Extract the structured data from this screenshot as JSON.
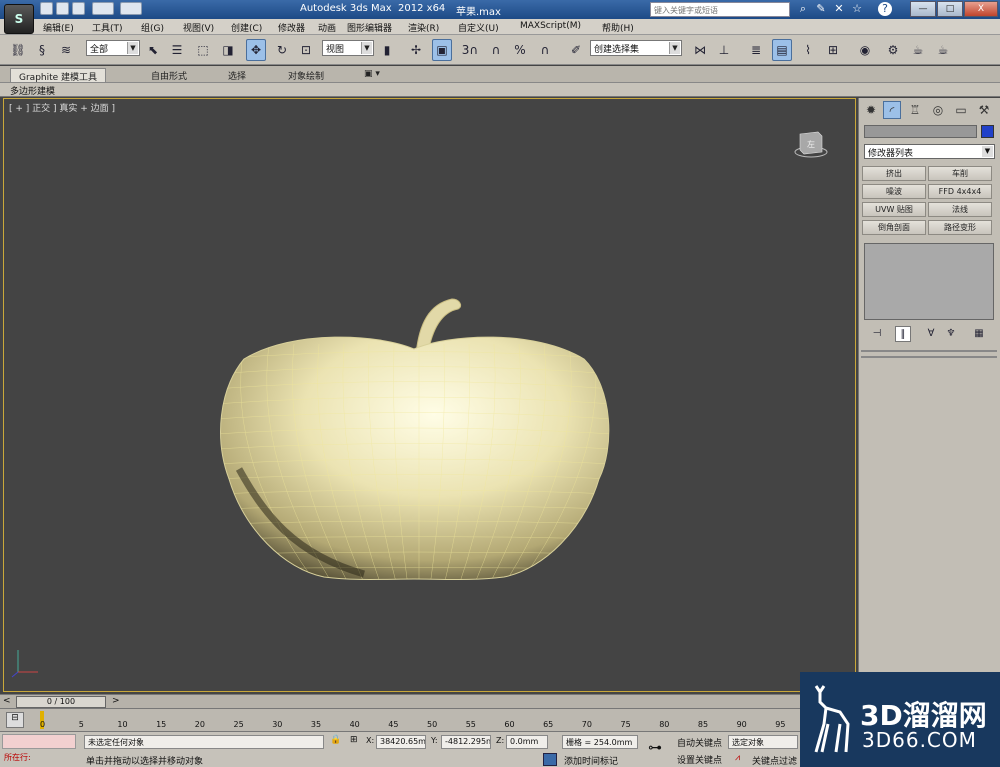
{
  "titlebar": {
    "app_title": "Autodesk 3ds Max  2012 x64",
    "file_name": "苹果.max",
    "search_placeholder": "键入关键字或短语",
    "help_label": "?",
    "min_label": "—",
    "max_label": "□",
    "close_label": "X"
  },
  "menu": [
    "编辑(E)",
    "工具(T)",
    "组(G)",
    "视图(V)",
    "创建(C)",
    "修改器",
    "动画",
    "图形编辑器",
    "渲染(R)",
    "自定义(U)",
    "MAXScript(M)",
    "帮助(H)"
  ],
  "toolbar": {
    "selection_filter": "全部",
    "ref_coord": "视图",
    "named_selection": "创建选择集",
    "snap_label": "3",
    "percent_label": "%"
  },
  "ribbon": {
    "tabs": [
      "Graphite 建模工具",
      "自由形式",
      "选择",
      "对象绘制"
    ],
    "panel_label": "多边形建模"
  },
  "viewport": {
    "label": "[ + ] 正交 ] 真实 + 边面 ]",
    "viewcube_label": "左"
  },
  "command_panel": {
    "modifier_list": "修改器列表",
    "modifier_buttons": [
      "挤出",
      "车削",
      "噪波",
      "FFD 4x4x4",
      "UVW 贴图",
      "法线",
      "倒角剖面",
      "路径变形"
    ],
    "colors": {
      "object_color": "#2040c8"
    }
  },
  "timeline": {
    "frame_display": "0 / 100",
    "ticks": [
      "0",
      "5",
      "10",
      "15",
      "20",
      "25",
      "30",
      "35",
      "40",
      "45",
      "50",
      "55",
      "60",
      "65",
      "70",
      "75",
      "80",
      "85",
      "90",
      "95"
    ]
  },
  "status": {
    "script_label": "所在行:",
    "selection_text": "未选定任何对象",
    "prompt_text": "单击并拖动以选择并移动对象",
    "x_label": "X:",
    "x_value": "38420.65m",
    "y_label": "Y:",
    "y_value": "-4812.295n",
    "z_label": "Z:",
    "z_value": "0.0mm",
    "grid_text": "栅格 = 254.0mm",
    "add_time_tag": "添加时间标记",
    "auto_key": "自动关键点",
    "set_key": "设置关键点",
    "selected_object": "选定对象",
    "key_filters": "关键点过滤"
  },
  "watermark": {
    "brand": "3D溜溜网",
    "url": "3D66.COM"
  }
}
